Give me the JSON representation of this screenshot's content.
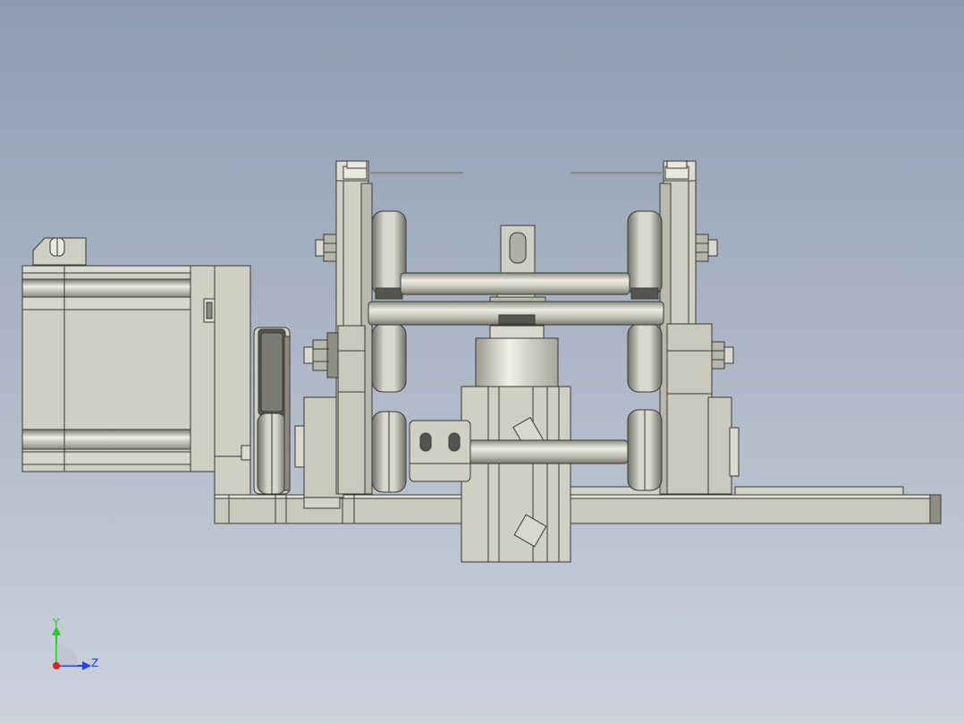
{
  "viewport": {
    "background_top": "#8E9CB1",
    "background_bottom": "#CDD2DD"
  },
  "model": {
    "body_color": "#CFCFC3",
    "body_light": "#E4E4DA",
    "body_dark": "#9C9C90",
    "edge_color": "#3A3A36",
    "dark_part_color": "#555550"
  },
  "triad": {
    "y_label": "Y",
    "z_label": "Z",
    "y_color": "#22CC22",
    "z_color": "#2244DD",
    "x_color": "#DD2222"
  }
}
